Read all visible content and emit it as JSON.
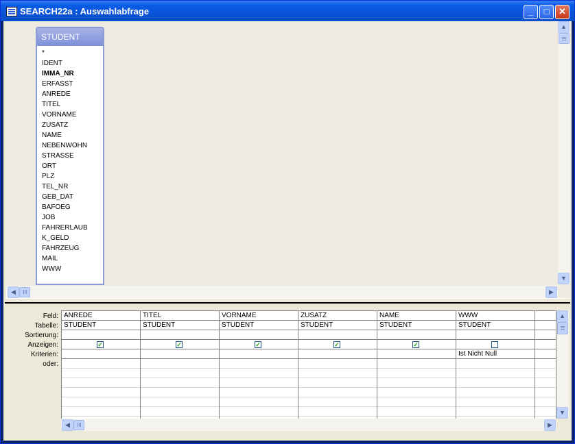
{
  "window": {
    "title": "SEARCH22a : Auswahlabfrage"
  },
  "table": {
    "name": "STUDENT",
    "fields": [
      "*",
      "IDENT",
      "IMMA_NR",
      "ERFASST",
      "ANREDE",
      "TITEL",
      "VORNAME",
      "ZUSATZ",
      "NAME",
      "NEBENWOHN",
      "STRASSE",
      "ORT",
      "PLZ",
      "TEL_NR",
      "GEB_DAT",
      "BAFOEG",
      "JOB",
      "FAHRERLAUB",
      "K_GELD",
      "FAHRZEUG",
      "MAIL",
      "WWW"
    ],
    "bold_field": "IMMA_NR"
  },
  "grid": {
    "row_labels": [
      "Feld:",
      "Tabelle:",
      "Sortierung:",
      "Anzeigen:",
      "Kriterien:",
      "oder:"
    ],
    "columns": [
      {
        "field": "ANREDE",
        "table": "STUDENT",
        "sort": "",
        "show": true,
        "criteria": "",
        "or": ""
      },
      {
        "field": "TITEL",
        "table": "STUDENT",
        "sort": "",
        "show": true,
        "criteria": "",
        "or": ""
      },
      {
        "field": "VORNAME",
        "table": "STUDENT",
        "sort": "",
        "show": true,
        "criteria": "",
        "or": ""
      },
      {
        "field": "ZUSATZ",
        "table": "STUDENT",
        "sort": "",
        "show": true,
        "criteria": "",
        "or": ""
      },
      {
        "field": "NAME",
        "table": "STUDENT",
        "sort": "",
        "show": true,
        "criteria": "",
        "or": ""
      },
      {
        "field": "WWW",
        "table": "STUDENT",
        "sort": "",
        "show": false,
        "criteria": "Ist Nicht Null",
        "or": ""
      }
    ]
  },
  "icons": {
    "app": "query-icon",
    "minimize": "minimize-icon",
    "maximize": "maximize-icon",
    "close": "close-icon",
    "check": "check-icon"
  },
  "colors": {
    "titlebar": "#0b5ce7",
    "table_header": "#7e8fd8",
    "design_area": "#f0ebe1"
  }
}
